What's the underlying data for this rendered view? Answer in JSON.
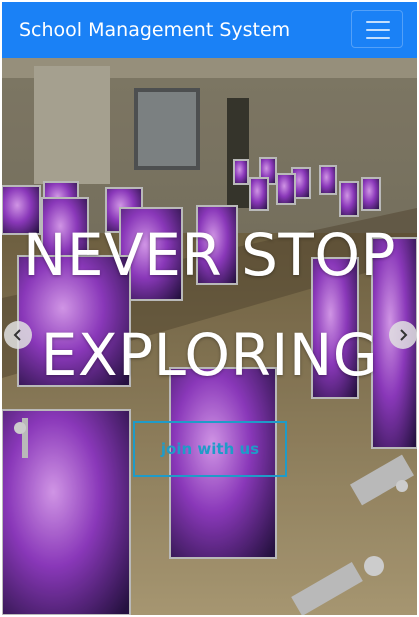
{
  "navbar": {
    "brand": "School Management System",
    "toggler_icon": "hamburger-menu-icon",
    "color": "#1a81f6"
  },
  "hero": {
    "headline_line1": "NEVER STOP",
    "headline_line2": "EXPLORING",
    "cta_label": "join with us",
    "cta_color": "#1f9bc8",
    "background": "computer lab with rows of desktop monitors",
    "prev_icon": "chevron-left-icon",
    "next_icon": "chevron-right-icon"
  }
}
